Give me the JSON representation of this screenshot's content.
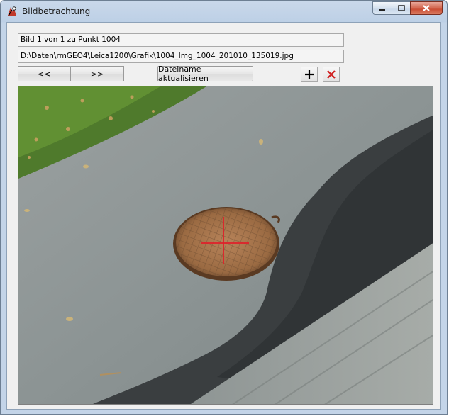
{
  "window": {
    "title": "Bildbetrachtung",
    "caption_buttons": [
      "minimize",
      "maximize",
      "close"
    ]
  },
  "info": {
    "image_counter": "Bild 1 von 1 zu Punkt 1004",
    "file_path": "D:\\Daten\\rmGEO4\\Leica1200\\Grafik\\1004_Img_1004_201010_135019.jpg"
  },
  "toolbar": {
    "prev_label": "<<",
    "next_label": ">>",
    "refresh_label": "Dateiname aktualisieren",
    "add_icon": "plus-icon",
    "delete_icon": "red-x-icon"
  },
  "colors": {
    "accent_red": "#d02020",
    "crosshair": "#e0202a"
  }
}
